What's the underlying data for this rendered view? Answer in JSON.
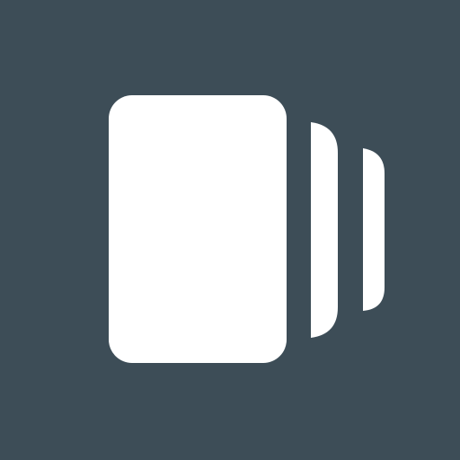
{
  "icon": {
    "name": "stacked-cards-icon",
    "background_color": "#3d4d57",
    "foreground_color": "#ffffff",
    "layers": [
      {
        "name": "front-card"
      },
      {
        "name": "middle-card"
      },
      {
        "name": "back-card"
      }
    ]
  }
}
